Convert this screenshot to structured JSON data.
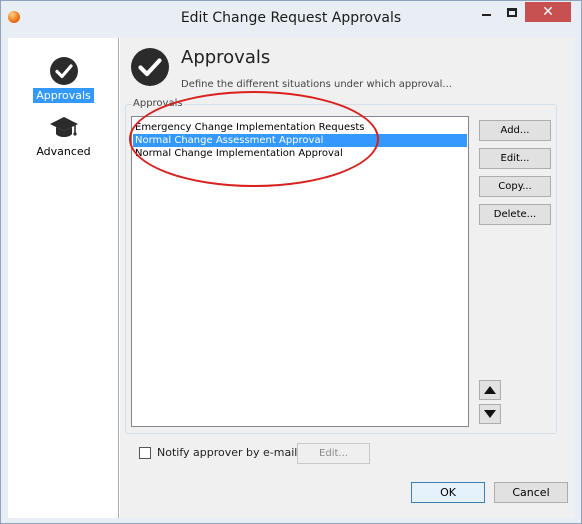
{
  "window": {
    "title": "Edit Change Request Approvals",
    "close_glyph": "✕"
  },
  "nav": {
    "items": [
      {
        "label": "Approvals",
        "icon": "checkmark-circle-icon",
        "selected": true
      },
      {
        "label": "Advanced",
        "icon": "graduation-cap-icon",
        "selected": false
      }
    ]
  },
  "header": {
    "title": "Approvals",
    "subtitle": "Define the different situations under which approval..."
  },
  "group": {
    "label": "Approvals",
    "items": [
      {
        "label": "Emergency Change Implementation Requests",
        "selected": false
      },
      {
        "label": "Normal Change Assessment Approval",
        "selected": true
      },
      {
        "label": "Normal Change Implementation Approval",
        "selected": false
      }
    ]
  },
  "buttons": {
    "add": "Add...",
    "edit": "Edit...",
    "copy": "Copy...",
    "delete": "Delete..."
  },
  "notify": {
    "label": "Notify approver by e-mail",
    "checked": false,
    "edit_label": "Edit..."
  },
  "footer": {
    "ok": "OK",
    "cancel": "Cancel"
  },
  "colors": {
    "selection": "#3399ff",
    "annotation": "#d8211e"
  }
}
